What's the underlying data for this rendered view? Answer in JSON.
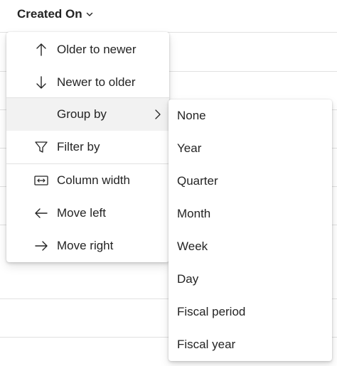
{
  "column": {
    "header_label": "Created On",
    "header_icon": "chevron-down-icon"
  },
  "menu": {
    "items": [
      {
        "label": "Older to newer",
        "icon": "arrow-up-icon"
      },
      {
        "label": "Newer to older",
        "icon": "arrow-down-icon"
      },
      {
        "label": "Group by",
        "icon": "none",
        "has_submenu": true
      },
      {
        "label": "Filter by",
        "icon": "filter-icon"
      },
      {
        "label": "Column width",
        "icon": "column-width-icon"
      },
      {
        "label": "Move left",
        "icon": "arrow-left-icon"
      },
      {
        "label": "Move right",
        "icon": "arrow-right-icon"
      }
    ]
  },
  "group_by_submenu": {
    "items": [
      {
        "label": "None"
      },
      {
        "label": "Year"
      },
      {
        "label": "Quarter"
      },
      {
        "label": "Month"
      },
      {
        "label": "Week"
      },
      {
        "label": "Day"
      },
      {
        "label": "Fiscal period"
      },
      {
        "label": "Fiscal year"
      }
    ]
  }
}
